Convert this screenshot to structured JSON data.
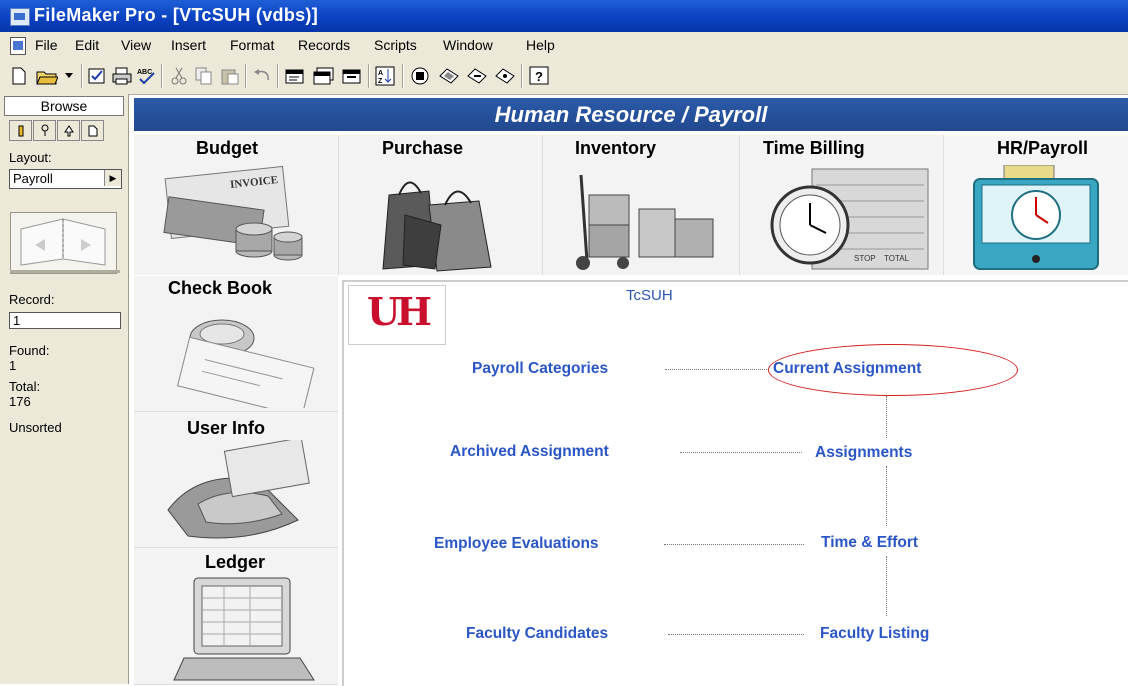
{
  "window": {
    "title": "FileMaker Pro - [VTcSUH (vdbs)]"
  },
  "menu": [
    "File",
    "Edit",
    "View",
    "Insert",
    "Format",
    "Records",
    "Scripts",
    "Window",
    "Help"
  ],
  "status": {
    "mode": "Browse",
    "layout_label": "Layout:",
    "layout_value": "Payroll",
    "record_label": "Record:",
    "record_value": "1",
    "found_label": "Found:",
    "found_value": "1",
    "total_label": "Total:",
    "total_value": "176",
    "sort_state": "Unsorted"
  },
  "header": {
    "title": "Human Resource / Payroll"
  },
  "top_tiles": [
    {
      "label": "Budget",
      "img_label": "INVOICE"
    },
    {
      "label": "Purchase"
    },
    {
      "label": "Inventory"
    },
    {
      "label": "Time Billing",
      "img_labels": [
        "STOP",
        "TOTAL"
      ]
    },
    {
      "label": "HR/Payroll"
    }
  ],
  "left_tiles": [
    {
      "label": "Check Book"
    },
    {
      "label": "User Info"
    },
    {
      "label": "Ledger"
    }
  ],
  "content": {
    "logo": "UH",
    "subtitle": "TcSUH",
    "links": {
      "payroll_categories": "Payroll Categories",
      "current_assignment": "Current Assignment",
      "archived_assignment": "Archived Assignment",
      "assignments": "Assignments",
      "employee_evaluations": "Employee Evaluations",
      "time_effort": "Time & Effort",
      "faculty_candidates": "Faculty Candidates",
      "faculty_listing": "Faculty Listing"
    }
  },
  "colors": {
    "header_bg": "#21498f",
    "link": "#2a56c6",
    "highlight_circle": "#d52020",
    "logo": "#c8102e"
  }
}
